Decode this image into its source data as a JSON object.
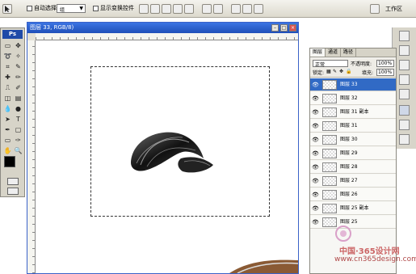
{
  "options_bar": {
    "auto_select_label": "自动选择:",
    "auto_select_value": "组",
    "show_transform_label": "显示变换控件",
    "workspace_label": "工作区"
  },
  "toolbox": {
    "logo": "Ps"
  },
  "document": {
    "title": "图层 33, RGB/8)"
  },
  "layers_panel": {
    "tabs": [
      "图层",
      "通道",
      "路径"
    ],
    "blend_mode": "正常",
    "opacity_label": "不透明度:",
    "opacity_value": "100%",
    "lock_label": "锁定:",
    "fill_label": "填充:",
    "fill_value": "100%",
    "layers": [
      {
        "name": "图层 33",
        "selected": true
      },
      {
        "name": "图层 32",
        "selected": false
      },
      {
        "name": "图层 31 副本",
        "selected": false
      },
      {
        "name": "图层 31",
        "selected": false
      },
      {
        "name": "图层 30",
        "selected": false
      },
      {
        "name": "图层 29",
        "selected": false
      },
      {
        "name": "图层 28",
        "selected": false
      },
      {
        "name": "图层 27",
        "selected": false
      },
      {
        "name": "图层 26",
        "selected": false
      },
      {
        "name": "图层 25 副本",
        "selected": false
      },
      {
        "name": "图层 25",
        "selected": false
      }
    ]
  },
  "watermark": {
    "line1": "中国·365设计网",
    "line2": "www.cn365design.com"
  },
  "colors": {
    "title_bar": "#2a5fcf",
    "selected_layer": "#316ac5",
    "foreground": "#000000",
    "background": "#f5c9b0"
  }
}
